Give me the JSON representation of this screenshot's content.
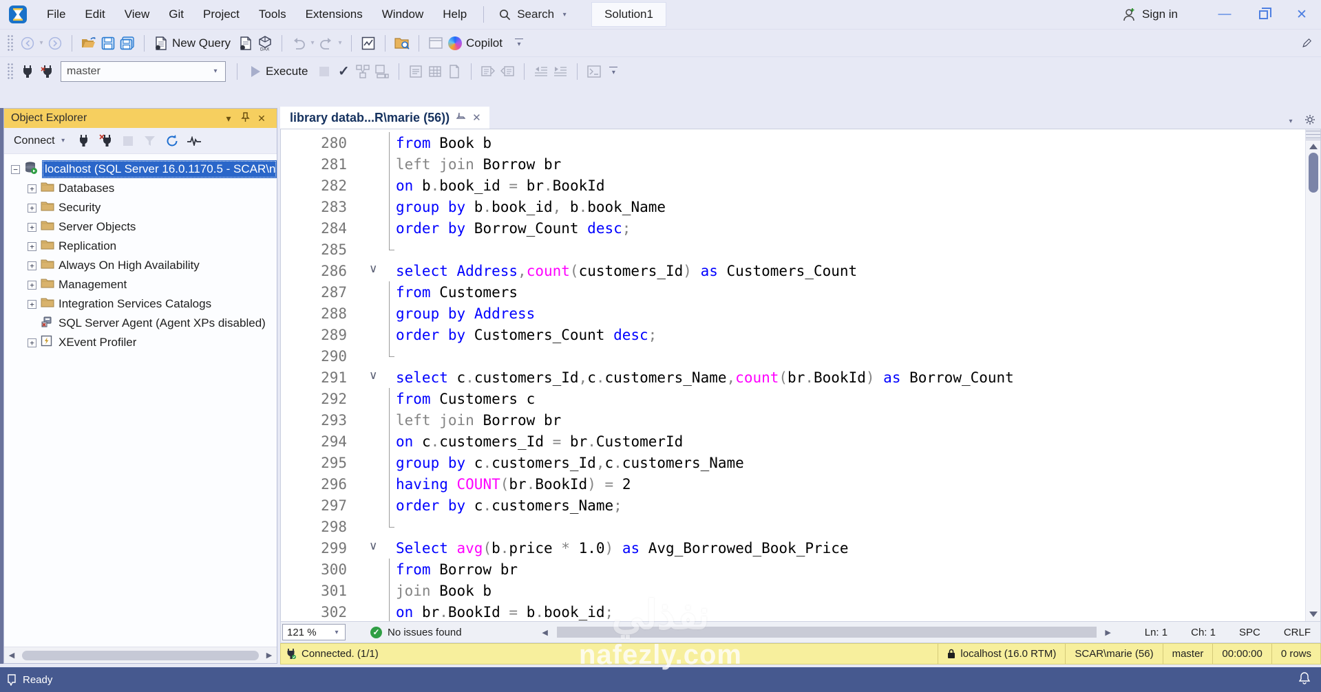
{
  "titlebar": {
    "menu_items": [
      "File",
      "Edit",
      "View",
      "Git",
      "Project",
      "Tools",
      "Extensions",
      "Window",
      "Help"
    ],
    "search_label": "Search",
    "solution_label": "Solution1",
    "sign_in_label": "Sign in"
  },
  "toolbar": {
    "new_query_label": "New Query",
    "copilot_label": "Copilot",
    "database_combo_value": "master",
    "execute_label": "Execute"
  },
  "object_explorer": {
    "title": "Object Explorer",
    "connect_label": "Connect",
    "tree": [
      {
        "label": "localhost (SQL Server 16.0.1170.5 - SCAR\\n",
        "icon": "server",
        "expander": "minus",
        "selected": true,
        "indent": 0
      },
      {
        "label": "Databases",
        "icon": "folder",
        "expander": "plus",
        "selected": false,
        "indent": 1
      },
      {
        "label": "Security",
        "icon": "folder",
        "expander": "plus",
        "selected": false,
        "indent": 1
      },
      {
        "label": "Server Objects",
        "icon": "folder",
        "expander": "plus",
        "selected": false,
        "indent": 1
      },
      {
        "label": "Replication",
        "icon": "folder",
        "expander": "plus",
        "selected": false,
        "indent": 1
      },
      {
        "label": "Always On High Availability",
        "icon": "folder",
        "expander": "plus",
        "selected": false,
        "indent": 1
      },
      {
        "label": "Management",
        "icon": "folder",
        "expander": "plus",
        "selected": false,
        "indent": 1
      },
      {
        "label": "Integration Services Catalogs",
        "icon": "folder",
        "expander": "plus",
        "selected": false,
        "indent": 1
      },
      {
        "label": "SQL Server Agent (Agent XPs disabled)",
        "icon": "agent",
        "expander": "none",
        "selected": false,
        "indent": 1
      },
      {
        "label": "XEvent Profiler",
        "icon": "xevent",
        "expander": "plus",
        "selected": false,
        "indent": 1
      }
    ]
  },
  "editor": {
    "tab_title": "library datab...R\\marie (56))",
    "zoom_value": "121 %",
    "issues_label": "No issues found",
    "ln_label": "Ln: 1",
    "ch_label": "Ch: 1",
    "spc_label": "SPC",
    "eol_label": "CRLF",
    "lines": [
      {
        "n": "280",
        "m": "guide",
        "tokens": [
          [
            "k",
            "from"
          ],
          [
            "d",
            " Book b"
          ]
        ]
      },
      {
        "n": "281",
        "m": "guide",
        "tokens": [
          [
            "g",
            "left join"
          ],
          [
            "d",
            " Borrow br"
          ]
        ]
      },
      {
        "n": "282",
        "m": "guide",
        "tokens": [
          [
            "k",
            "on"
          ],
          [
            "d",
            " b"
          ],
          [
            "g",
            "."
          ],
          [
            "d",
            "book_id "
          ],
          [
            "g",
            "="
          ],
          [
            "d",
            " br"
          ],
          [
            "g",
            "."
          ],
          [
            "d",
            "BookId"
          ]
        ]
      },
      {
        "n": "283",
        "m": "guide",
        "tokens": [
          [
            "k",
            "group by"
          ],
          [
            "d",
            " b"
          ],
          [
            "g",
            "."
          ],
          [
            "d",
            "book_id"
          ],
          [
            "g",
            ","
          ],
          [
            "d",
            " b"
          ],
          [
            "g",
            "."
          ],
          [
            "d",
            "book_Name"
          ]
        ]
      },
      {
        "n": "284",
        "m": "guide",
        "tokens": [
          [
            "k",
            "order by"
          ],
          [
            "d",
            " Borrow_Count "
          ],
          [
            "k",
            "desc"
          ],
          [
            "g",
            ";"
          ]
        ]
      },
      {
        "n": "285",
        "m": "end",
        "tokens": []
      },
      {
        "n": "286",
        "m": "fold",
        "tokens": [
          [
            "k",
            "select"
          ],
          [
            "d",
            " "
          ],
          [
            "k",
            "Address"
          ],
          [
            "g",
            ","
          ],
          [
            "f",
            "count"
          ],
          [
            "g",
            "("
          ],
          [
            "d",
            "customers_Id"
          ],
          [
            "g",
            ")"
          ],
          [
            "d",
            " "
          ],
          [
            "k",
            "as"
          ],
          [
            "d",
            " Customers_Count"
          ]
        ]
      },
      {
        "n": "287",
        "m": "guide",
        "tokens": [
          [
            "k",
            "from"
          ],
          [
            "d",
            " Customers"
          ]
        ]
      },
      {
        "n": "288",
        "m": "guide",
        "tokens": [
          [
            "k",
            "group by"
          ],
          [
            "d",
            " "
          ],
          [
            "k",
            "Address"
          ]
        ]
      },
      {
        "n": "289",
        "m": "guide",
        "tokens": [
          [
            "k",
            "order by"
          ],
          [
            "d",
            " Customers_Count "
          ],
          [
            "k",
            "desc"
          ],
          [
            "g",
            ";"
          ]
        ]
      },
      {
        "n": "290",
        "m": "end",
        "tokens": []
      },
      {
        "n": "291",
        "m": "fold",
        "tokens": [
          [
            "k",
            "select"
          ],
          [
            "d",
            " c"
          ],
          [
            "g",
            "."
          ],
          [
            "d",
            "customers_Id"
          ],
          [
            "g",
            ","
          ],
          [
            "d",
            "c"
          ],
          [
            "g",
            "."
          ],
          [
            "d",
            "customers_Name"
          ],
          [
            "g",
            ","
          ],
          [
            "f",
            "count"
          ],
          [
            "g",
            "("
          ],
          [
            "d",
            "br"
          ],
          [
            "g",
            "."
          ],
          [
            "d",
            "BookId"
          ],
          [
            "g",
            ")"
          ],
          [
            "d",
            " "
          ],
          [
            "k",
            "as"
          ],
          [
            "d",
            " Borrow_Count"
          ]
        ]
      },
      {
        "n": "292",
        "m": "guide",
        "tokens": [
          [
            "k",
            "from"
          ],
          [
            "d",
            " Customers c"
          ]
        ]
      },
      {
        "n": "293",
        "m": "guide",
        "tokens": [
          [
            "g",
            "left join"
          ],
          [
            "d",
            " Borrow br"
          ]
        ]
      },
      {
        "n": "294",
        "m": "guide",
        "tokens": [
          [
            "k",
            "on"
          ],
          [
            "d",
            " c"
          ],
          [
            "g",
            "."
          ],
          [
            "d",
            "customers_Id "
          ],
          [
            "g",
            "="
          ],
          [
            "d",
            " br"
          ],
          [
            "g",
            "."
          ],
          [
            "d",
            "CustomerId"
          ]
        ]
      },
      {
        "n": "295",
        "m": "guide",
        "tokens": [
          [
            "k",
            "group by"
          ],
          [
            "d",
            " c"
          ],
          [
            "g",
            "."
          ],
          [
            "d",
            "customers_Id"
          ],
          [
            "g",
            ","
          ],
          [
            "d",
            "c"
          ],
          [
            "g",
            "."
          ],
          [
            "d",
            "customers_Name"
          ]
        ]
      },
      {
        "n": "296",
        "m": "guide",
        "tokens": [
          [
            "k",
            "having"
          ],
          [
            "d",
            " "
          ],
          [
            "f",
            "COUNT"
          ],
          [
            "g",
            "("
          ],
          [
            "d",
            "br"
          ],
          [
            "g",
            "."
          ],
          [
            "d",
            "BookId"
          ],
          [
            "g",
            ")"
          ],
          [
            "d",
            " "
          ],
          [
            "g",
            "="
          ],
          [
            "d",
            " 2"
          ]
        ]
      },
      {
        "n": "297",
        "m": "guide",
        "tokens": [
          [
            "k",
            "order by"
          ],
          [
            "d",
            " c"
          ],
          [
            "g",
            "."
          ],
          [
            "d",
            "customers_Name"
          ],
          [
            "g",
            ";"
          ]
        ]
      },
      {
        "n": "298",
        "m": "end",
        "tokens": []
      },
      {
        "n": "299",
        "m": "fold",
        "tokens": [
          [
            "k",
            "Select"
          ],
          [
            "d",
            " "
          ],
          [
            "f",
            "avg"
          ],
          [
            "g",
            "("
          ],
          [
            "d",
            "b"
          ],
          [
            "g",
            "."
          ],
          [
            "d",
            "price "
          ],
          [
            "g",
            "*"
          ],
          [
            "d",
            " 1.0"
          ],
          [
            "g",
            ")"
          ],
          [
            "d",
            " "
          ],
          [
            "k",
            "as"
          ],
          [
            "d",
            " Avg_Borrowed_Book_Price"
          ]
        ]
      },
      {
        "n": "300",
        "m": "guide",
        "tokens": [
          [
            "k",
            "from"
          ],
          [
            "d",
            " Borrow br"
          ]
        ]
      },
      {
        "n": "301",
        "m": "guide",
        "tokens": [
          [
            "g",
            "join"
          ],
          [
            "d",
            " Book b"
          ]
        ]
      },
      {
        "n": "302",
        "m": "guide",
        "tokens": [
          [
            "k",
            "on"
          ],
          [
            "d",
            " br"
          ],
          [
            "g",
            "."
          ],
          [
            "d",
            "BookId "
          ],
          [
            "g",
            "="
          ],
          [
            "d",
            " b"
          ],
          [
            "g",
            "."
          ],
          [
            "d",
            "book_id"
          ],
          [
            "g",
            ";"
          ]
        ]
      }
    ]
  },
  "connection_bar": {
    "status": "Connected. (1/1)",
    "server": "localhost (16.0 RTM)",
    "user": "SCAR\\marie (56)",
    "database": "master",
    "duration": "00:00:00",
    "rows": "0 rows"
  },
  "statusbar": {
    "ready_label": "Ready"
  },
  "watermark": {
    "line1": "نفذلي",
    "line2": "nafezly.com"
  },
  "colors": {
    "keyword": "#0000ff",
    "operator": "#848484",
    "function": "#ff00ff",
    "panel_header_gold": "#f6cf5f",
    "selection_blue": "#2a66c9",
    "connected_bar_yellow": "#f7ef9d",
    "statusbar_blue": "#46598f"
  }
}
